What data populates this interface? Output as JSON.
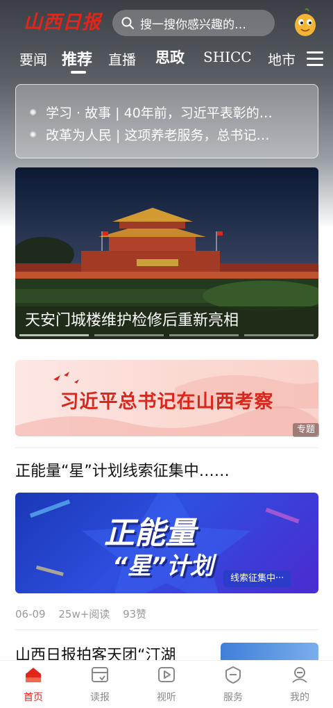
{
  "header": {
    "logo_text": "山西日报",
    "search_placeholder": "搜一搜你感兴趣的…"
  },
  "nav": {
    "tabs": [
      {
        "label": "要闻"
      },
      {
        "label": "推荐"
      },
      {
        "label": "直播"
      },
      {
        "label": "思政"
      },
      {
        "label": "SHICC"
      },
      {
        "label": "地市"
      }
    ],
    "active_tab": "推荐"
  },
  "notices": [
    {
      "text": "学习 · 故事 | 40年前，习近平表彰的…"
    },
    {
      "text": "改革为人民 | 这项养老服务，总书记…"
    }
  ],
  "carousel": {
    "caption": "天安门城楼维护检修后重新亮相",
    "slide_count": 4,
    "active_index": 0
  },
  "banner": {
    "text": "习近平总书记在山西考察",
    "tag": "专题"
  },
  "article": {
    "title": "正能量“星”计划线索征集中……",
    "image_text_main": "正能量",
    "image_text_sub": "“星”计划",
    "image_badge": "线索征集中···",
    "date": "06-09",
    "reads": "25w+阅读",
    "likes": "93赞"
  },
  "next_article": {
    "title": "山西日报拍客天团“汀湖"
  },
  "tabbar": {
    "items": [
      {
        "label": "首页",
        "icon": "home-icon"
      },
      {
        "label": "读报",
        "icon": "newspaper-icon"
      },
      {
        "label": "视听",
        "icon": "video-icon"
      },
      {
        "label": "服务",
        "icon": "service-icon"
      },
      {
        "label": "我的",
        "icon": "profile-icon"
      }
    ],
    "active": "首页"
  },
  "colors": {
    "brand_red": "#e1251b",
    "inactive_gray": "#888888"
  }
}
